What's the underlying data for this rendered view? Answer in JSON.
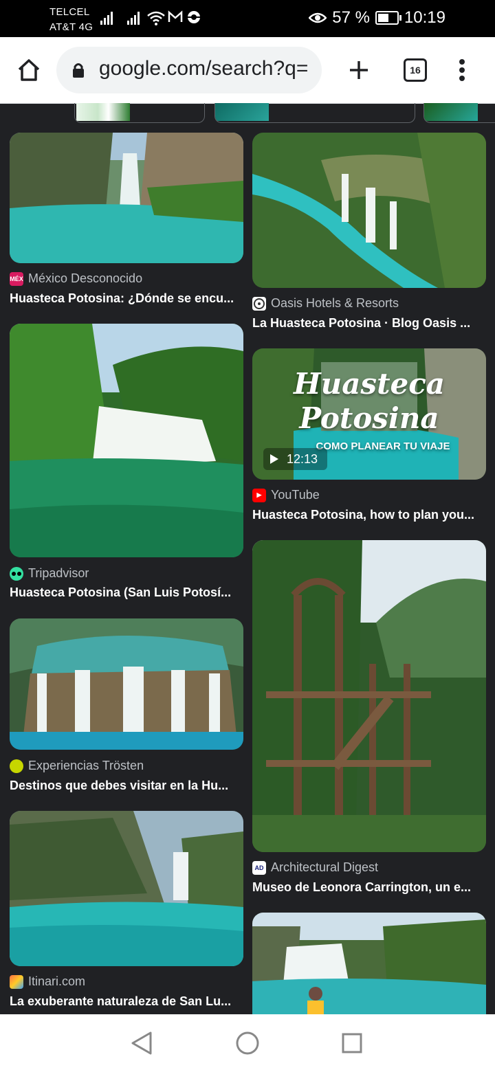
{
  "status_bar": {
    "carrier_line1": "TELCEL",
    "carrier_line2": "AT&T 4G",
    "battery_percent": "57 %",
    "battery_level": 0.57,
    "time": "10:19",
    "icons": [
      "signal-icon",
      "signal-icon",
      "wifi-icon",
      "gmail-icon",
      "sync-icon",
      "eye-icon",
      "battery-icon"
    ]
  },
  "toolbar": {
    "url": "google.com/search?q=",
    "tab_count": "16",
    "icons": [
      "home-icon",
      "lock-icon",
      "new-tab-icon",
      "tab-switcher-icon",
      "more-vert-icon"
    ]
  },
  "results": {
    "left": [
      {
        "source": "México Desconocido",
        "favicon_text": "MÉX",
        "favicon_color": "#d81b60",
        "title": "Huasteca Potosina: ¿Dónde se encu..."
      },
      {
        "source": "Tripadvisor",
        "favicon_text": "",
        "favicon_color": "#34e0a1",
        "title": "Huasteca Potosina (San Luis Potosí..."
      },
      {
        "source": "Experiencias Trösten",
        "favicon_text": "",
        "favicon_color": "#c6d600",
        "title": "Destinos que debes visitar en la Hu..."
      },
      {
        "source": "Itinari.com",
        "favicon_text": "",
        "favicon_color": "#ff7043",
        "title": "La exuberante naturaleza de San Lu..."
      }
    ],
    "right": [
      {
        "source": "Oasis Hotels & Resorts",
        "favicon_text": "",
        "favicon_color": "#ffffff",
        "title": "La Huasteca Potosina · Blog Oasis ..."
      },
      {
        "source": "YouTube",
        "favicon_text": "▶",
        "favicon_color": "#ff0000",
        "title": "Huasteca Potosina, how to plan you...",
        "video_duration": "12:13",
        "overlay_line1": "Huasteca",
        "overlay_line2": "Potosina",
        "overlay_line3": "COMO PLANEAR TU VIAJE"
      },
      {
        "source": "Architectural Digest",
        "favicon_text": "AD",
        "favicon_color": "#ffffff",
        "title": "Museo de Leonora Carrington, un e..."
      }
    ]
  },
  "navbar": {
    "icons": [
      "back-triangle-icon",
      "home-circle-icon",
      "recents-square-icon"
    ]
  }
}
